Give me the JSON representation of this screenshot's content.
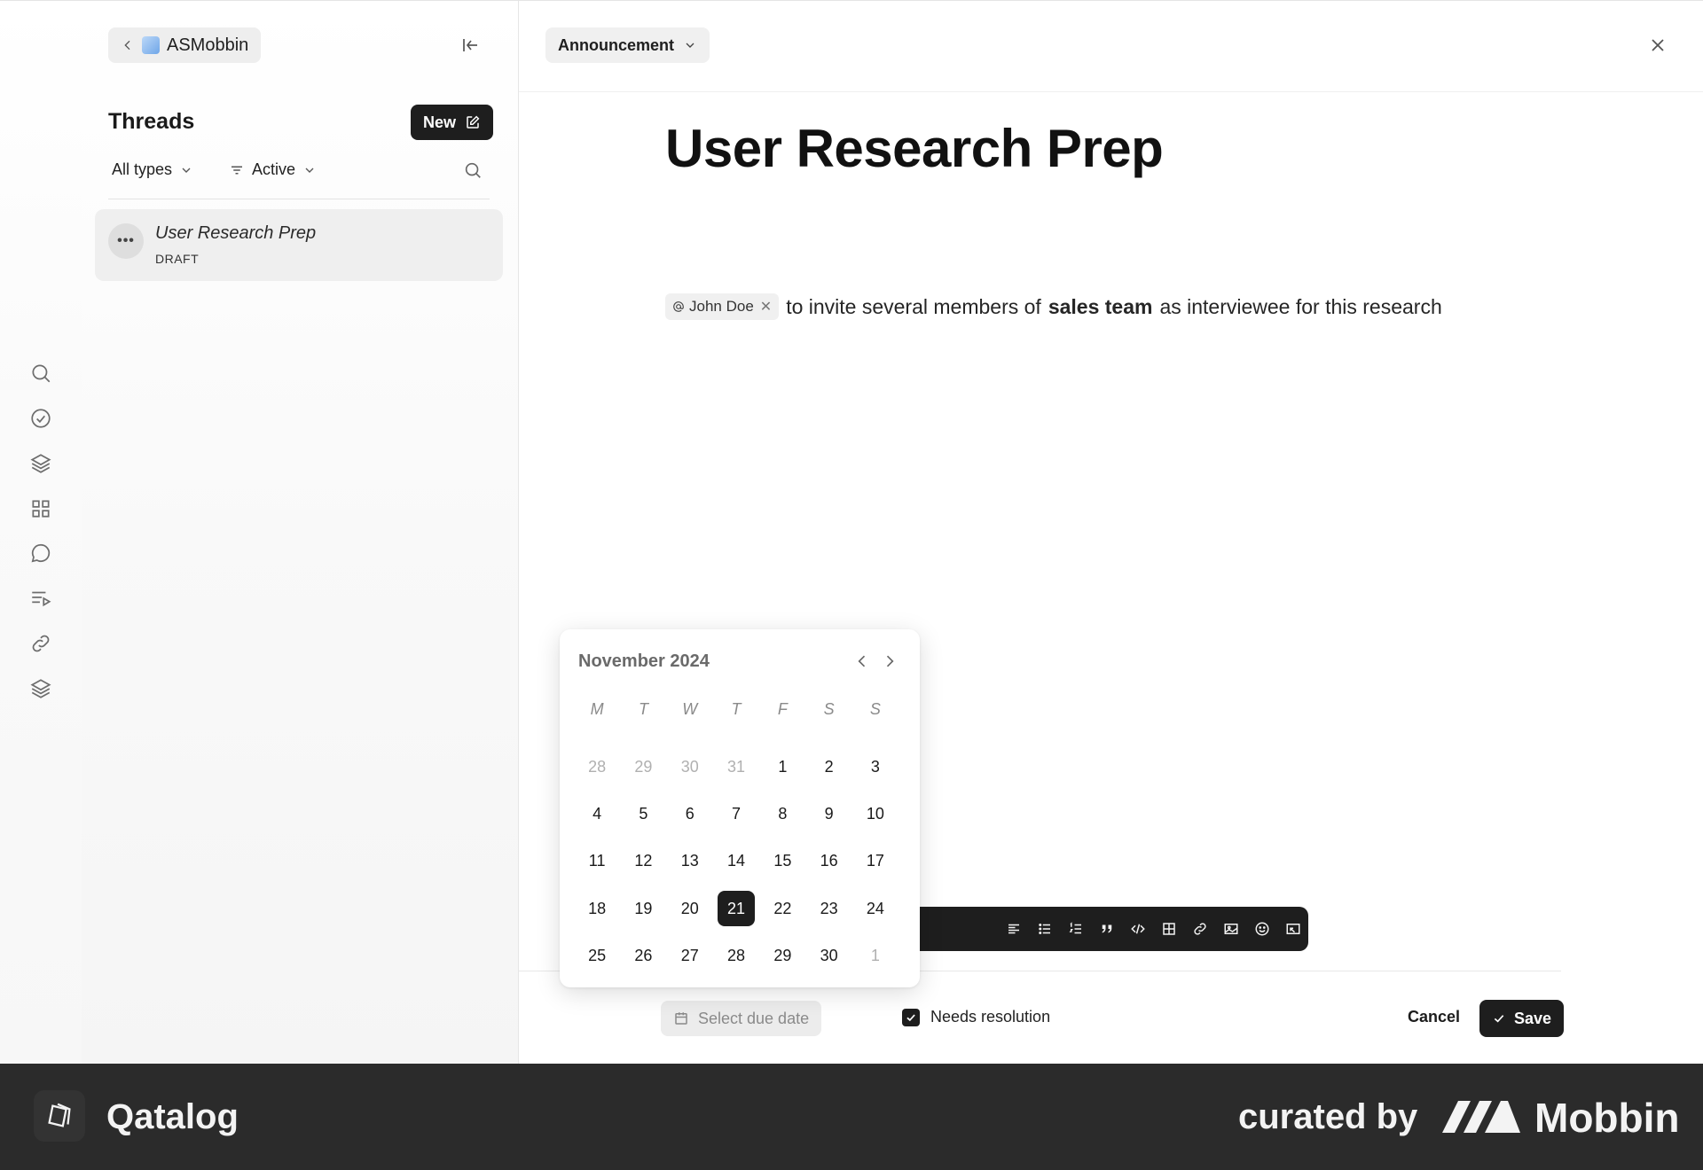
{
  "rail": {
    "icons": [
      "search-icon",
      "check-circle-icon",
      "layers-icon",
      "grid-icon",
      "chat-bubble-icon",
      "list-play-icon",
      "link-icon",
      "stack-icon"
    ]
  },
  "threads_panel": {
    "workspace_name": "ASMobbin",
    "title": "Threads",
    "new_label": "New",
    "filter_types": "All types",
    "filter_status": "Active",
    "items": [
      {
        "avatar": "•••",
        "title": "User Research Prep",
        "status": "DRAFT"
      }
    ]
  },
  "editor": {
    "type_label": "Announcement",
    "title": "User Research Prep",
    "body": {
      "mention": "John Doe",
      "text_before": "to invite several members of",
      "bold": "sales team",
      "text_after": "as interviewee for this research"
    },
    "toolbar_icons": [
      "align-left-icon",
      "bullet-list-icon",
      "numbered-list-icon",
      "quote-icon",
      "code-icon",
      "table-icon",
      "link-icon",
      "image-icon",
      "emoji-icon",
      "embed-icon"
    ],
    "due_date_label": "Select due date",
    "needs_resolution_label": "Needs resolution",
    "needs_resolution_checked": true,
    "cancel_label": "Cancel",
    "save_label": "Save"
  },
  "calendar": {
    "month_label": "November 2024",
    "weekdays": [
      "M",
      "T",
      "W",
      "T",
      "F",
      "S",
      "S"
    ],
    "days": [
      [
        "28",
        "29",
        "30",
        "31",
        "1",
        "2",
        "3"
      ],
      [
        "4",
        "5",
        "6",
        "7",
        "8",
        "9",
        "10"
      ],
      [
        "11",
        "12",
        "13",
        "14",
        "15",
        "16",
        "17"
      ],
      [
        "18",
        "19",
        "20",
        "21",
        "22",
        "23",
        "24"
      ],
      [
        "25",
        "26",
        "27",
        "28",
        "29",
        "30",
        "1"
      ]
    ],
    "selected_day": "21"
  },
  "brand_bar": {
    "app_name": "Qatalog",
    "curated_by": "curated by",
    "curator": "Mobbin"
  },
  "colors": {
    "accent_dark": "#1e1e1e",
    "brand_bar": "#2b2b2b"
  }
}
